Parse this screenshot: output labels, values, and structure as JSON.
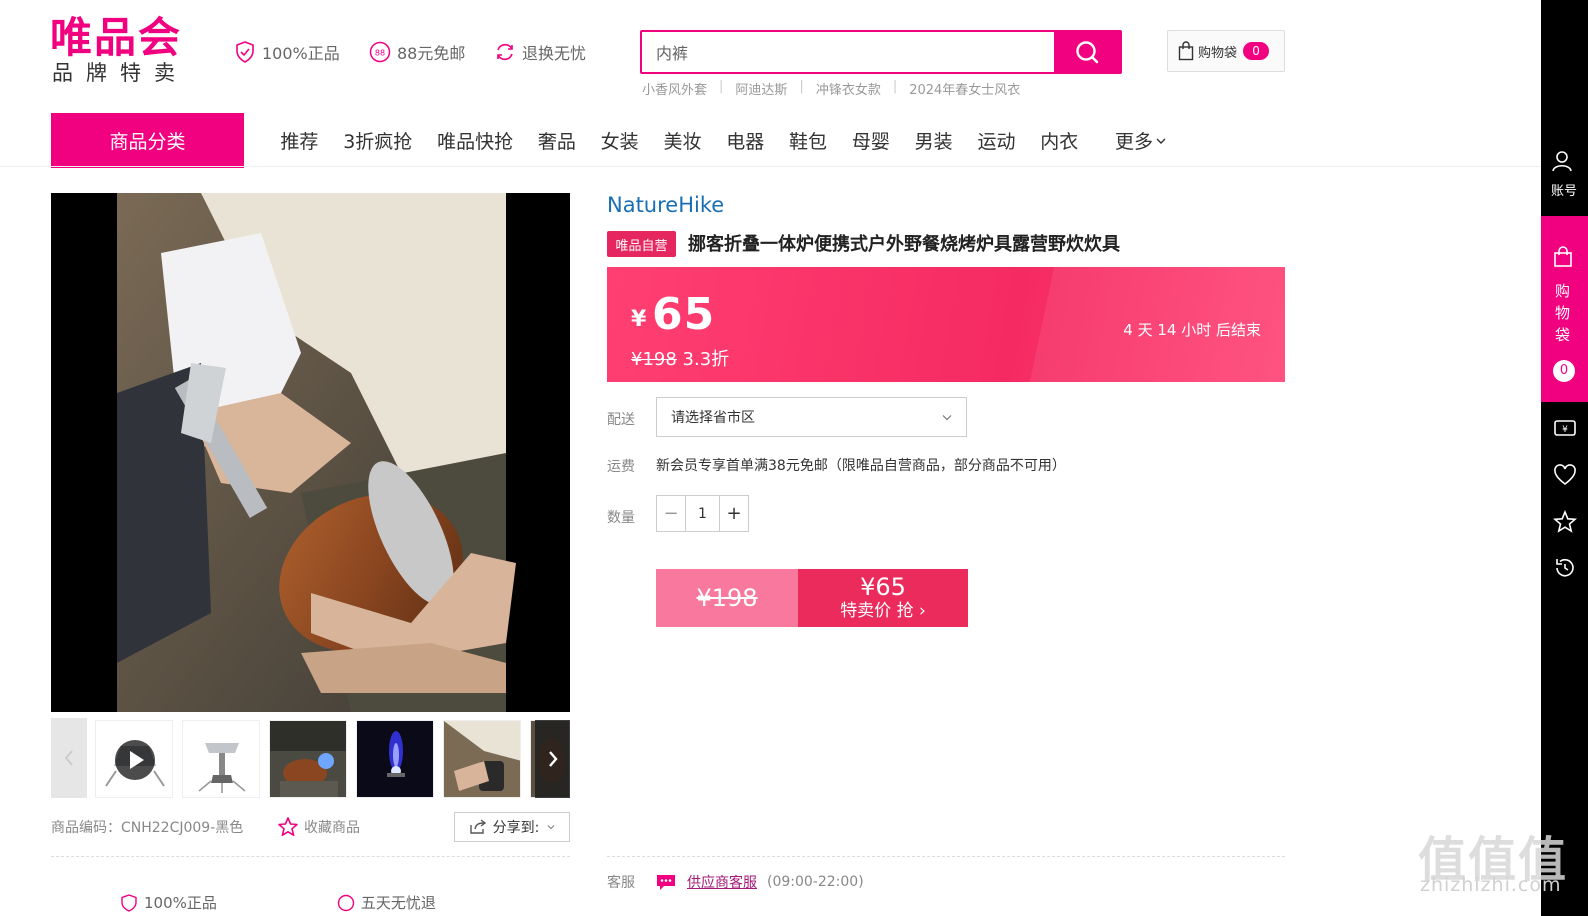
{
  "header": {
    "logo_main": "唯品会",
    "logo_sub": "品牌特卖",
    "promises": [
      {
        "icon": "shield-check-icon",
        "label": "100%正品"
      },
      {
        "icon": "free-shipping-88-icon",
        "label": "88元免邮"
      },
      {
        "icon": "return-refresh-icon",
        "label": "退换无忧"
      }
    ],
    "search": {
      "value": "内裤",
      "icon": "search-icon"
    },
    "hot_words": [
      "小香风外套",
      "阿迪达斯",
      "冲锋衣女款",
      "2024年春女士风衣"
    ],
    "cart": {
      "label": "购物袋",
      "count": "0",
      "icon": "shopping-bag-icon"
    }
  },
  "nav": {
    "category_button": "商品分类",
    "items": [
      "推荐",
      "3折疯抢",
      "唯品快抢",
      "奢品",
      "女装",
      "美妆",
      "电器",
      "鞋包",
      "母婴",
      "男装",
      "运动",
      "内衣"
    ],
    "more": "更多"
  },
  "gallery": {
    "thumbnails": [
      "video-play",
      "stove-product",
      "stove-in-use",
      "blue-flame",
      "stove-hand-held",
      "stove-side"
    ],
    "product_code_label": "商品编码：",
    "product_code": "CNH22CJ009-黑色",
    "favorite_label": "收藏商品",
    "share_label": "分享到:"
  },
  "bottom_badges": [
    "100%正品",
    "五天无忧退"
  ],
  "product": {
    "brand": "NatureHike",
    "self_tag": "唯品自营",
    "title": "挪客折叠一体炉便携式户外野餐烧烤炉具露营野炊炊具",
    "currency": "¥",
    "price": "65",
    "original_price": "¥198",
    "discount": "3.3折",
    "countdown": "4 天 14 小时 后结束"
  },
  "delivery": {
    "label": "配送",
    "placeholder": "请选择省市区"
  },
  "shipping": {
    "label": "运费",
    "text": "新会员专享首单满38元免邮（限唯品自营商品，部分商品不可用）"
  },
  "quantity": {
    "label": "数量",
    "value": "1",
    "minus": "−",
    "plus": "+"
  },
  "buy_button": {
    "original": "¥198",
    "price": "¥65",
    "text": "特卖价 抢 ›"
  },
  "service": {
    "label": "客服",
    "link": "供应商客服",
    "hours": "(09:00-22:00)"
  },
  "sidebar": {
    "account_label": "账号",
    "bag_label": "购物袋",
    "bag_count": "0"
  },
  "watermark": {
    "main": "值值值",
    "sub": "zhizhizhi.com"
  },
  "colors": {
    "brand": "#f10180",
    "price_red": "#f52a62",
    "link_blue": "#1a6fb3"
  }
}
